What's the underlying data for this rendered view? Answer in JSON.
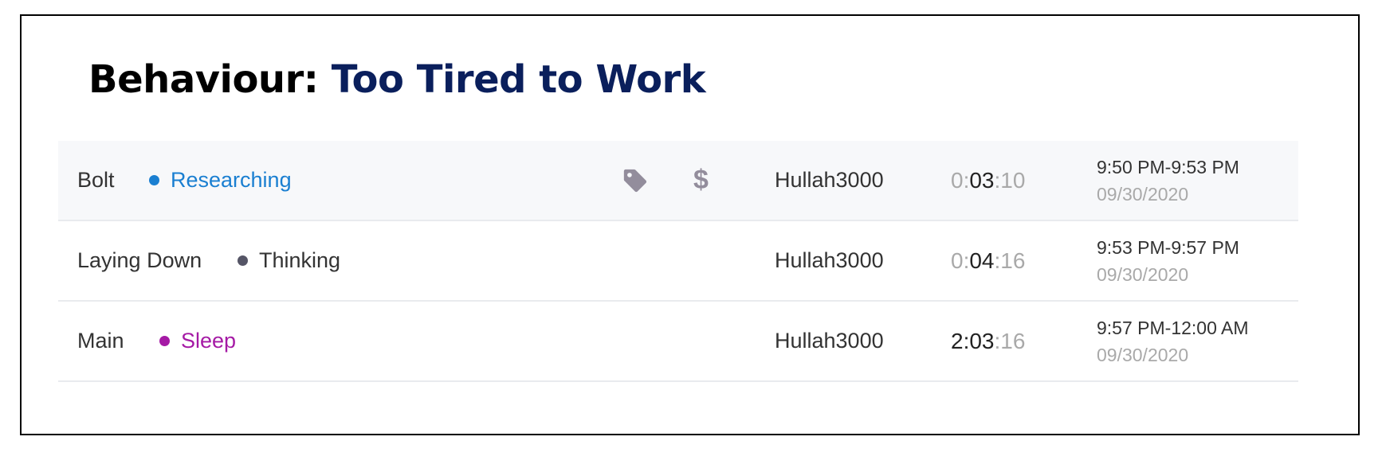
{
  "title": {
    "prefix": "Behaviour:",
    "name": "Too Tired to Work"
  },
  "colors": {
    "title_name": "#0a1f5c",
    "researching": "#1a7fd1",
    "thinking": "#555566",
    "sleep": "#a51aa5",
    "icon_gray": "#938d9c"
  },
  "rows": [
    {
      "project": "Bolt",
      "task": "Researching",
      "task_color": "#1a7fd1",
      "icons": [
        "tag-icon",
        "dollar-icon"
      ],
      "user": "Hullah3000",
      "duration": {
        "h": "0",
        "sep1": ":",
        "m": "03",
        "sep2": ":",
        "s": "10"
      },
      "time_range": "9:50 PM-9:53 PM",
      "date": "09/30/2020"
    },
    {
      "project": "Laying Down",
      "task": "Thinking",
      "task_color": "#555566",
      "user": "Hullah3000",
      "duration": {
        "h": "0",
        "sep1": ":",
        "m": "04",
        "sep2": ":",
        "s": "16"
      },
      "time_range": "9:53 PM-9:57 PM",
      "date": "09/30/2020"
    },
    {
      "project": "Main",
      "task": "Sleep",
      "task_color": "#a51aa5",
      "user": "Hullah3000",
      "duration": {
        "h": "2",
        "sep1": ":",
        "m": "03",
        "sep2": ":",
        "s": "16"
      },
      "time_range": "9:57 PM-12:00 AM",
      "date": "09/30/2020"
    }
  ]
}
